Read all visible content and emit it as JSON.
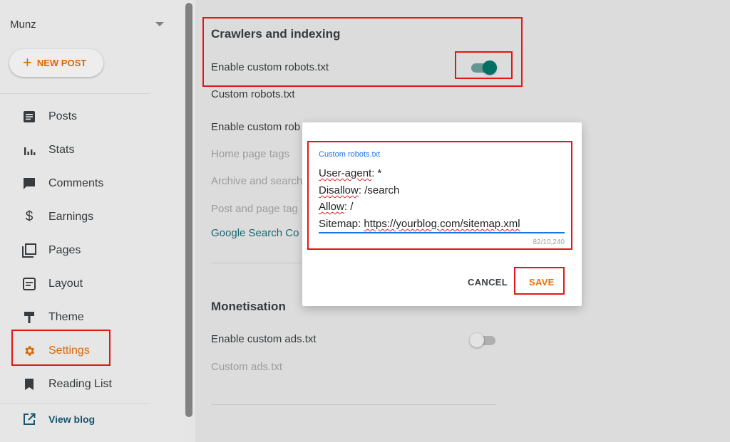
{
  "sidebar": {
    "blog_name": "Munz",
    "new_post": "NEW POST",
    "items": [
      {
        "label": "Posts",
        "icon": "posts-icon"
      },
      {
        "label": "Stats",
        "icon": "stats-icon"
      },
      {
        "label": "Comments",
        "icon": "comments-icon"
      },
      {
        "label": "Earnings",
        "icon": "earnings-icon"
      },
      {
        "label": "Pages",
        "icon": "pages-icon"
      },
      {
        "label": "Layout",
        "icon": "layout-icon"
      },
      {
        "label": "Theme",
        "icon": "theme-icon"
      },
      {
        "label": "Settings",
        "icon": "gear-icon",
        "active": true
      },
      {
        "label": "Reading List",
        "icon": "bookmark-icon"
      }
    ],
    "view_blog": "View blog"
  },
  "crawlers": {
    "heading": "Crawlers and indexing",
    "enable_robots": "Enable custom robots.txt",
    "robots_toggle_on": true,
    "custom_robots": "Custom robots.txt",
    "enable_robots_header": "Enable custom rob",
    "home_page_tags": "Home page tags",
    "archive_search": "Archive and search",
    "post_page_tags": "Post and page tag",
    "google_search_console": "Google Search Co"
  },
  "monetisation": {
    "heading": "Monetisation",
    "enable_ads": "Enable custom ads.txt",
    "ads_toggle_on": false,
    "custom_ads": "Custom ads.txt"
  },
  "dialog": {
    "field_label": "Custom robots.txt",
    "lines": {
      "l1_a": "User-agent",
      "l1_b": ": *",
      "l2_a": "Disallow",
      "l2_b": ": /search",
      "l3_a": "Allow",
      "l3_b": ": /",
      "l4_a": "Sitemap: ",
      "l4_b": "https://yourblog.com/sitemap.xml"
    },
    "counter": "82/10,240",
    "cancel": "CANCEL",
    "save": "SAVE"
  },
  "colors": {
    "accent_orange": "#e8710a",
    "toggle_teal": "#00796b",
    "link_teal": "#1a6e77",
    "focus_blue": "#1a73e8",
    "highlight_red": "#e31717"
  }
}
